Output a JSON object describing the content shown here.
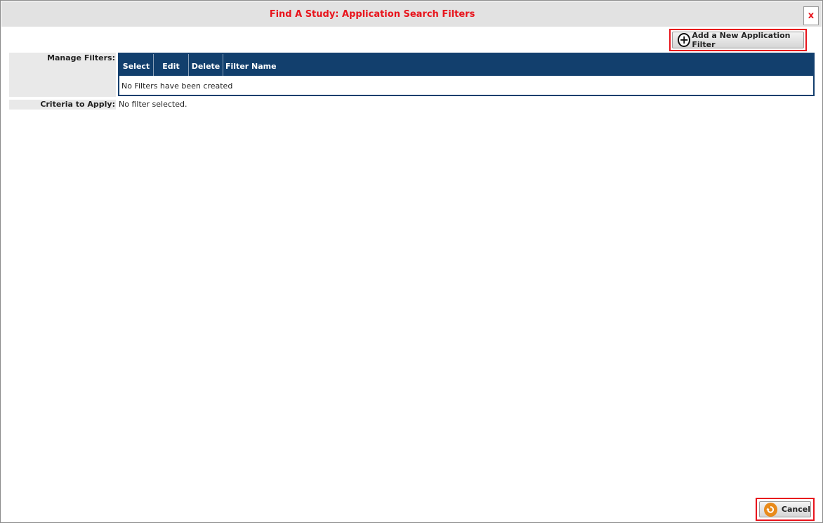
{
  "dialog": {
    "title": "Find A Study: Application Search Filters",
    "close_label": "x"
  },
  "toolbar": {
    "add_filter_label": "Add a New Application Filter",
    "add_icon": "plus-circle-icon"
  },
  "manage_filters": {
    "label": "Manage Filters:",
    "columns": [
      "Select",
      "Edit",
      "Delete",
      "Filter Name"
    ],
    "empty_message": "No Filters have been created"
  },
  "criteria": {
    "label": "Criteria to Apply:",
    "value": "No filter selected."
  },
  "footer": {
    "cancel_label": "Cancel",
    "cancel_icon": "undo-icon"
  },
  "colors": {
    "title_red": "#e8141c",
    "table_header_blue": "#123f6d",
    "label_bg": "#e9e9e9",
    "cancel_icon_orange": "#e88a1a"
  }
}
